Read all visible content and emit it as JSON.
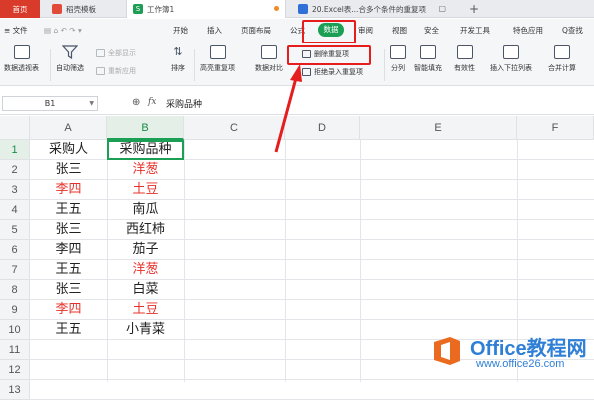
{
  "tabs": {
    "home": "首页",
    "doc1": "稻壳模板",
    "doc2": "工作簿1",
    "doc3": "20.Excel表...合多个条件的重复项",
    "plus": "+"
  },
  "menu": {
    "file": "≡ 文件",
    "items": [
      "开始",
      "插入",
      "页面布局",
      "公式",
      "数据",
      "审阅",
      "视图",
      "安全",
      "开发工具",
      "特色应用"
    ],
    "search": "Q查找"
  },
  "ribbon": {
    "pivot": "数据透视表",
    "autofilter": "自动筛选",
    "show_all": "全部显示",
    "reapply": "重新应用",
    "sort": "排序",
    "highlight_dup": "高亮重复项",
    "compare": "数据对比",
    "remove_dup": "删除重复项",
    "reject_dup": "拒绝录入重复项",
    "split": "分列",
    "smart_fill": "智能填充",
    "validity": "有效性",
    "dropdown": "插入下拉列表",
    "consolidate": "合并计算"
  },
  "formula_bar": {
    "cell_ref": "B1",
    "fx": "fx",
    "content": "采购品种"
  },
  "columns": [
    "A",
    "B",
    "C",
    "D",
    "E",
    "F"
  ],
  "rows": [
    "1",
    "2",
    "3",
    "4",
    "5",
    "6",
    "7",
    "8",
    "9",
    "10",
    "11",
    "12",
    "13"
  ],
  "table": [
    {
      "a": "采购人",
      "b": "采购品种",
      "a_red": false,
      "b_red": false
    },
    {
      "a": "张三",
      "b": "洋葱",
      "a_red": false,
      "b_red": true
    },
    {
      "a": "李四",
      "b": "土豆",
      "a_red": true,
      "b_red": true
    },
    {
      "a": "王五",
      "b": "南瓜",
      "a_red": false,
      "b_red": false
    },
    {
      "a": "张三",
      "b": "西红柿",
      "a_red": false,
      "b_red": false
    },
    {
      "a": "李四",
      "b": "茄子",
      "a_red": false,
      "b_red": false
    },
    {
      "a": "王五",
      "b": "洋葱",
      "a_red": false,
      "b_red": true
    },
    {
      "a": "张三",
      "b": "白菜",
      "a_red": false,
      "b_red": false
    },
    {
      "a": "李四",
      "b": "土豆",
      "a_red": true,
      "b_red": true
    },
    {
      "a": "王五",
      "b": "小青菜",
      "a_red": false,
      "b_red": false
    }
  ],
  "colors": {
    "accent": "#1b9f55",
    "duplicate": "#e8302a",
    "highlight_box": "#e51d1d"
  },
  "watermark": {
    "title": "Office教程网",
    "url": "www.office26.com"
  }
}
